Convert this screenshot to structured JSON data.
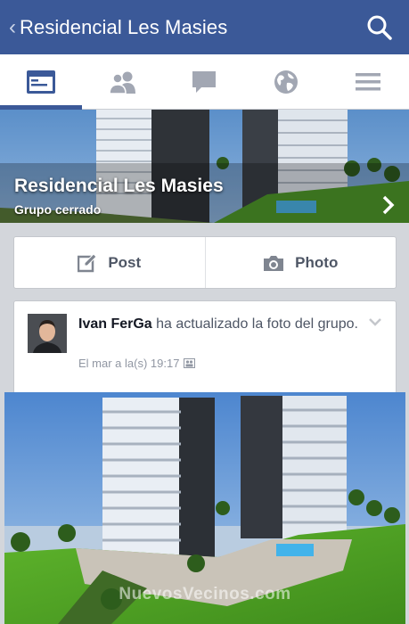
{
  "header": {
    "title": "Residencial Les Masies",
    "back_icon": "chevron-left-icon",
    "search_icon": "search-icon"
  },
  "tabs": [
    {
      "name": "timeline",
      "icon": "group-feed-icon",
      "active": true
    },
    {
      "name": "members",
      "icon": "members-icon",
      "active": false
    },
    {
      "name": "messages",
      "icon": "chat-icon",
      "active": false
    },
    {
      "name": "public",
      "icon": "globe-icon",
      "active": false
    },
    {
      "name": "menu",
      "icon": "menu-icon",
      "active": false
    }
  ],
  "cover": {
    "group_name": "Residencial Les Masies",
    "privacy": "Grupo cerrado"
  },
  "composer": {
    "post_label": "Post",
    "photo_label": "Photo"
  },
  "story": {
    "author": "Ivan FerGa",
    "action": " ha actualizado la foto del grupo.",
    "timestamp": "El mar a la(s) 19:17"
  },
  "photo": {
    "watermark": "NuevosVecinos.com"
  },
  "colors": {
    "brand": "#3b5998",
    "background": "#d3d6db"
  }
}
